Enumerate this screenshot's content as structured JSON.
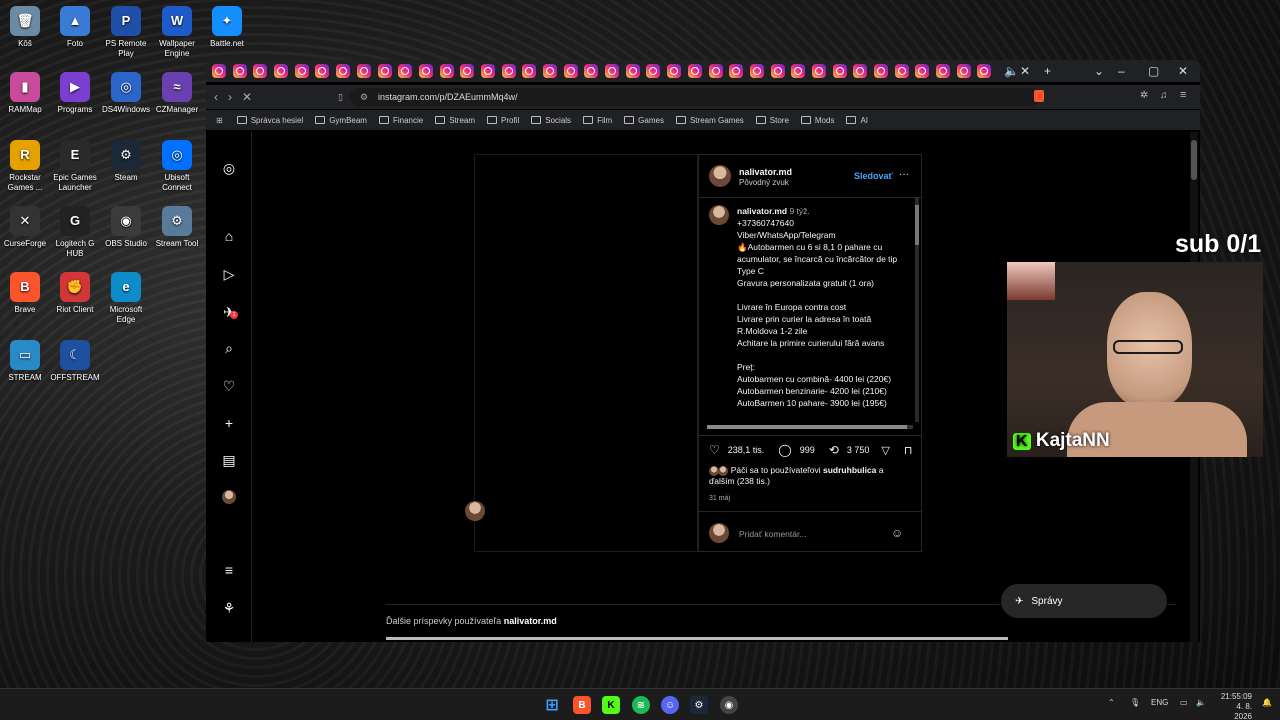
{
  "desktop_icons": [
    {
      "label": "Kôš",
      "glyph": "🗑",
      "color": "#6b8aa3"
    },
    {
      "label": "Foto",
      "glyph": "▲",
      "color": "#3a7bd5"
    },
    {
      "label": "PS Remote Play",
      "glyph": "P",
      "color": "#1f4fa8"
    },
    {
      "label": "Wallpaper Engine",
      "glyph": "W",
      "color": "#1e5ac8"
    },
    {
      "label": "Battle.net",
      "glyph": "✦",
      "color": "#148eff"
    },
    {
      "label": "RAMMap",
      "glyph": "▮",
      "color": "#c84a9a"
    },
    {
      "label": "Programs",
      "glyph": "▶",
      "color": "#7a3fd0"
    },
    {
      "label": "DS4Windows",
      "glyph": "◎",
      "color": "#2a66c9"
    },
    {
      "label": "CZManager",
      "glyph": "≈",
      "color": "#6a3fb0"
    },
    {
      "label": "Rockstar Games ...",
      "glyph": "R",
      "color": "#e5a100"
    },
    {
      "label": "Epic Games Launcher",
      "glyph": "E",
      "color": "#2a2a2a"
    },
    {
      "label": "Steam",
      "glyph": "⚙",
      "color": "#1b2838"
    },
    {
      "label": "Ubisoft Connect",
      "glyph": "◎",
      "color": "#0070ff"
    },
    {
      "label": "CurseForge",
      "glyph": "✕",
      "color": "#333"
    },
    {
      "label": "Logitech G HUB",
      "glyph": "G",
      "color": "#222"
    },
    {
      "label": "OBS Studio",
      "glyph": "◉",
      "color": "#3b3b3b"
    },
    {
      "label": "Stream Tool",
      "glyph": "⚙",
      "color": "#5a7a9a"
    },
    {
      "label": "Brave",
      "glyph": "B",
      "color": "#fb542b"
    },
    {
      "label": "Riot Client",
      "glyph": "✊",
      "color": "#d13639"
    },
    {
      "label": "Microsoft Edge",
      "glyph": "e",
      "color": "#0c8dc9"
    },
    {
      "label": "STREAM",
      "glyph": "▭",
      "color": "#2a8ac8"
    },
    {
      "label": "OFFSTREAM",
      "glyph": "☾",
      "color": "#1e4fa0"
    }
  ],
  "browser": {
    "url": "instagram.com/p/DZAEummMq4w/",
    "bookmarks": [
      "Správca hesiel",
      "GymBeam",
      "Financie",
      "Stream",
      "Profil",
      "Socials",
      "Film",
      "Games",
      "Stream Games",
      "Store",
      "Mods",
      "AI"
    ]
  },
  "post": {
    "username": "nalivator.md",
    "audio": "Pôvodný zvuk",
    "follow": "Sledovať",
    "more": "···",
    "caption_user": "nalivator.md",
    "caption_time": "9 týž.",
    "caption_lines": [
      "+37360747640",
      "Viber/WhatsApp/Telegram",
      "🔥Autobarmen cu 6 si 8,1 0 pahare cu acumulator, se încarcă cu încărcător de tip Type C",
      "Gravura personalizata gratuit (1 ora)",
      "",
      "Livrare în Europa contra cost",
      "Livrare prin curier la adresa în toată R.Moldova 1-2 zile",
      "Achitare la primire curierului fără avans",
      "",
      "Preț:",
      "Autobarmen cu combină- 4400 lei (220€)",
      "Autobarmen benzinarie- 4200 lei (210€)",
      "AutoBarmen 10 pahare- 3900 lei (195€)"
    ],
    "likes": "238,1 tis.",
    "comments": "999",
    "reposts": "3 750",
    "liked_by_prefix": "Páči sa to používateľovi",
    "liked_by_user": "sudruhbulica",
    "liked_by_suffix": "a ďalším (238 tis.)",
    "date": "31 máj",
    "comment_placeholder": "Pridať komentár..."
  },
  "more_posts_prefix": "Ďalšie príspevky používateľa",
  "more_posts_user": "nalivator.md",
  "messages_label": "Správy",
  "overlay": {
    "sub": "sub 0/1",
    "streamer": "KajtaNN"
  },
  "taskbar": {
    "lang": "ENG",
    "time": "21:55:09",
    "date": "4. 8. 2026"
  }
}
